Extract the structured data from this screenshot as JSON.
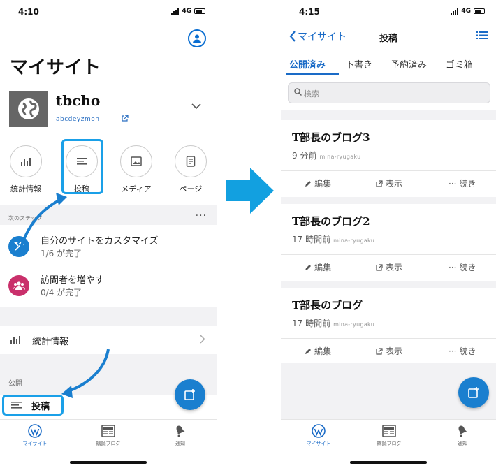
{
  "left": {
    "status": {
      "time": "4:10",
      "network": "4G"
    },
    "title": "マイサイト",
    "site": {
      "name": "tbcho",
      "url": "abcdeyzmon"
    },
    "quick_actions": [
      {
        "label": "統計情報",
        "icon": "bar-chart-icon"
      },
      {
        "label": "投稿",
        "icon": "posts-icon"
      },
      {
        "label": "メディア",
        "icon": "media-icon"
      },
      {
        "label": "ページ",
        "icon": "pages-icon"
      }
    ],
    "next_steps_label": "次のステップ",
    "tasks": [
      {
        "title": "自分のサイトをカスタマイズ",
        "sub": "1/6 が完了",
        "icon": "tools-icon",
        "color": "#1a7fcf"
      },
      {
        "title": "訪問者を増やす",
        "sub": "0/4 が完了",
        "icon": "people-icon",
        "color": "#c9306b"
      }
    ],
    "stats_row": "統計情報",
    "public_label": "公開",
    "posts_row": "投稿",
    "tabs": [
      {
        "label": "マイサイト",
        "icon": "wordpress-icon"
      },
      {
        "label": "購読ブログ",
        "icon": "reader-icon"
      },
      {
        "label": "通知",
        "icon": "bell-icon"
      }
    ]
  },
  "right": {
    "status": {
      "time": "4:15",
      "network": "4G"
    },
    "back_label": "マイサイト",
    "title": "投稿",
    "segments": [
      "公開済み",
      "下書き",
      "予約済み",
      "ゴミ箱"
    ],
    "search_placeholder": "検索",
    "actions": {
      "edit": "編集",
      "view": "表示",
      "more": "続き"
    },
    "posts": [
      {
        "title": "T部長のブログ3",
        "time": "9 分前",
        "site": "mina-ryugaku"
      },
      {
        "title": "T部長のブログ2",
        "time": "17 時間前",
        "site": "mina-ryugaku"
      },
      {
        "title": "T部長のブログ",
        "time": "17 時間前",
        "site": "mina-ryugaku"
      }
    ],
    "tabs": [
      {
        "label": "マイサイト",
        "icon": "wordpress-icon"
      },
      {
        "label": "購読ブログ",
        "icon": "reader-icon"
      },
      {
        "label": "通知",
        "icon": "bell-icon"
      }
    ]
  },
  "colors": {
    "accent": "#1a6bc7",
    "highlight": "#1aa0e8",
    "arrow": "#12a0e0"
  }
}
